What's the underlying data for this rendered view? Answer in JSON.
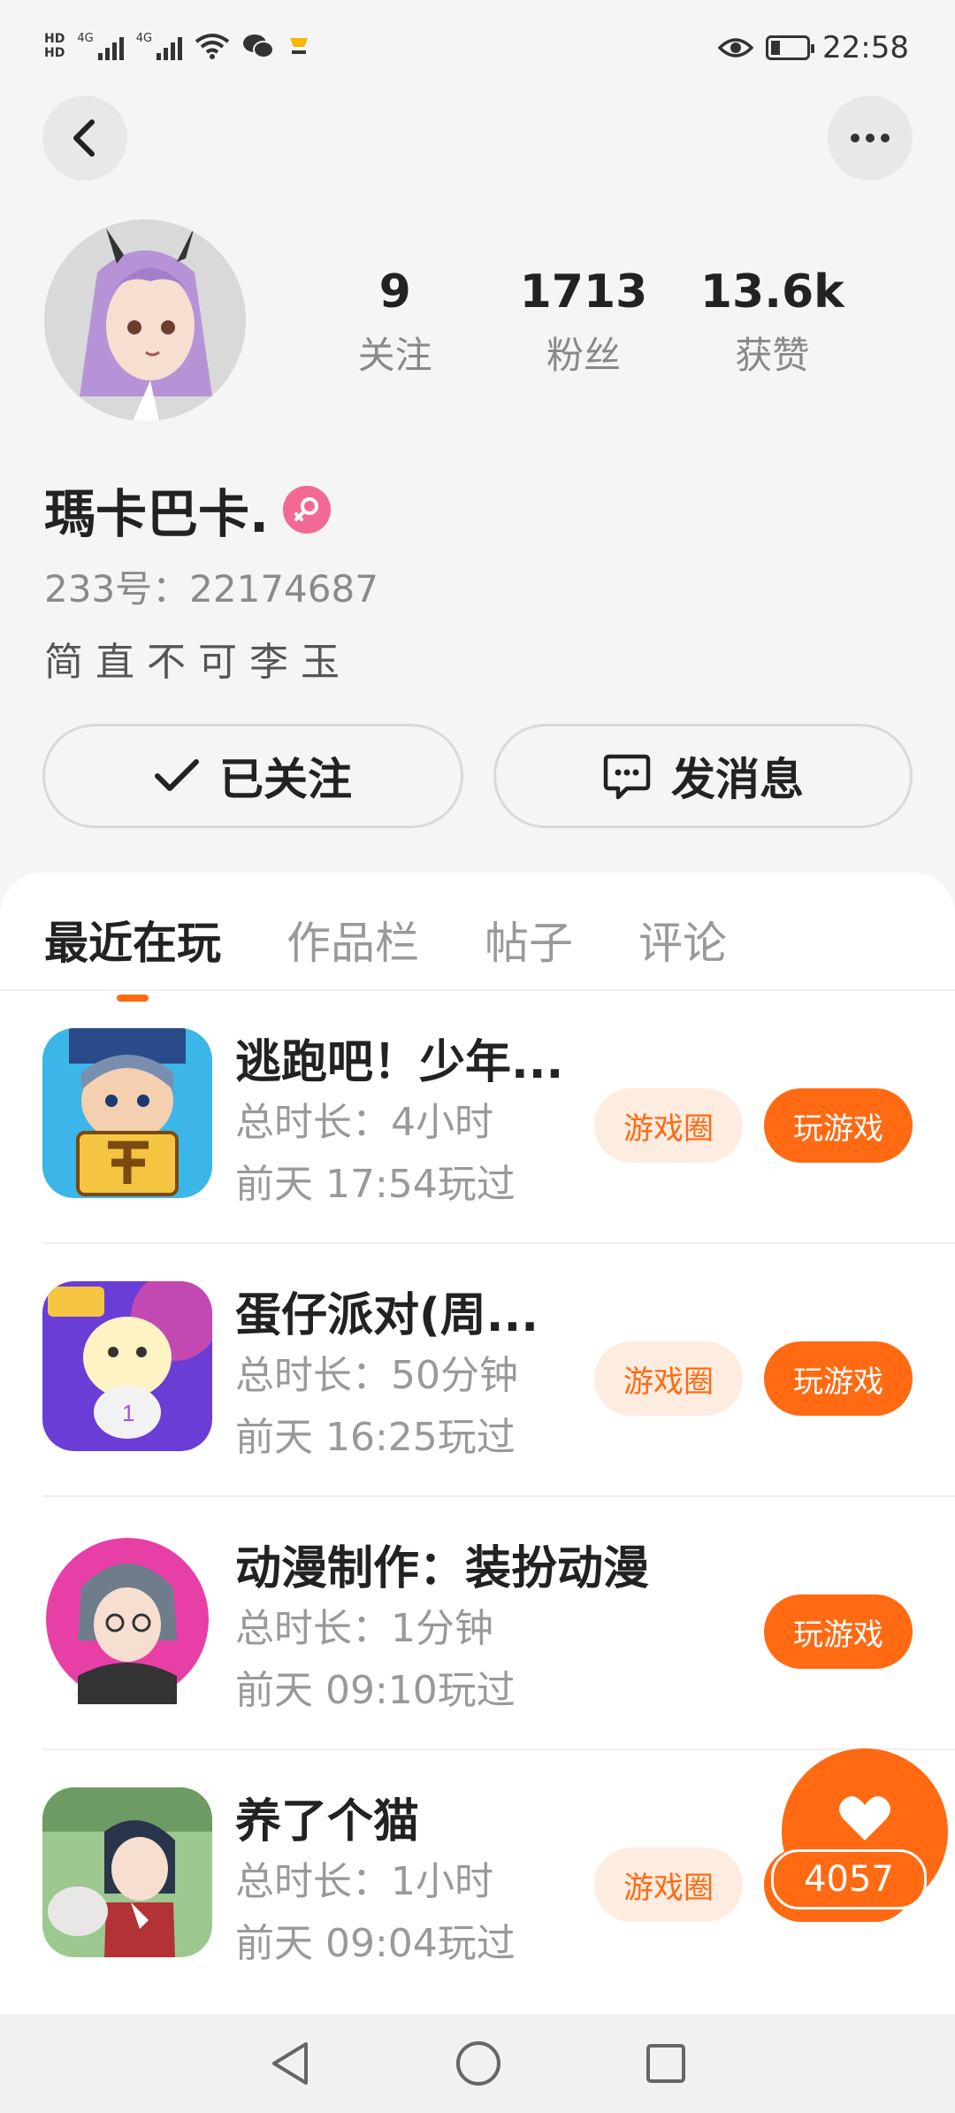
{
  "status_bar": {
    "time": "22:58",
    "hd1": "HD",
    "hd2": "HD",
    "net1": "4G",
    "net2": "4G",
    "icons": [
      "hd-icon",
      "signal-icon",
      "wifi-icon",
      "wechat-icon",
      "notification-icon",
      "eye-icon",
      "battery-icon"
    ]
  },
  "profile": {
    "stats": [
      {
        "value": "9",
        "label": "关注"
      },
      {
        "value": "1713",
        "label": "粉丝"
      },
      {
        "value": "13.6k",
        "label": "获赞"
      }
    ],
    "name": "瑪卡巴卡.",
    "gender": "female",
    "uid": "233号：22174687",
    "bio": "简直不可李玉",
    "follow_label": "已关注",
    "message_label": "发消息"
  },
  "tabs": [
    {
      "label": "最近在玩",
      "active": true
    },
    {
      "label": "作品栏",
      "active": false
    },
    {
      "label": "帖子",
      "active": false
    },
    {
      "label": "评论",
      "active": false
    }
  ],
  "games": [
    {
      "title": "逃跑吧！少年...",
      "duration": "总时长：4小时",
      "played": "前天 17:54玩过",
      "circle": "游戏圈",
      "play": "玩游戏"
    },
    {
      "title": "蛋仔派对(周...",
      "duration": "总时长：50分钟",
      "played": "前天 16:25玩过",
      "circle": "游戏圈",
      "play": "玩游戏"
    },
    {
      "title": "动漫制作：装扮动漫",
      "duration": "总时长：1分钟",
      "played": "前天 09:10玩过",
      "circle": "",
      "play": "玩游戏"
    },
    {
      "title": "养了个猫",
      "duration": "总时长：1小时",
      "played": "前天 09:04玩过",
      "circle": "游戏圈",
      "play": "玩游戏"
    }
  ],
  "like": {
    "count": "4057"
  },
  "colors": {
    "accent": "#ff6a13",
    "accent_light": "#fdece0",
    "gender_badge": "#f26a93"
  }
}
